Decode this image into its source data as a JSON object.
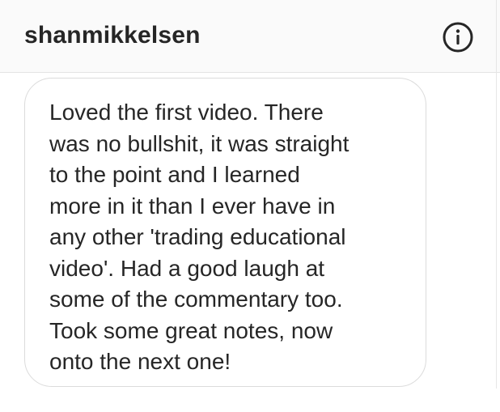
{
  "header": {
    "username": "shanmikkelsen",
    "info_icon": "info-circle-icon"
  },
  "message": {
    "text": "Loved the first video. There\nwas no bullshit, it was straight\nto the point and I learned\nmore in it than I ever have in\nany other 'trading educational\nvideo'. Had a good laugh at\nsome of the commentary too.\nTook some great notes, now\nonto the next one!"
  },
  "colors": {
    "text": "#262626",
    "header_background": "#fafafa",
    "bubble_border": "#dbdbdb"
  }
}
